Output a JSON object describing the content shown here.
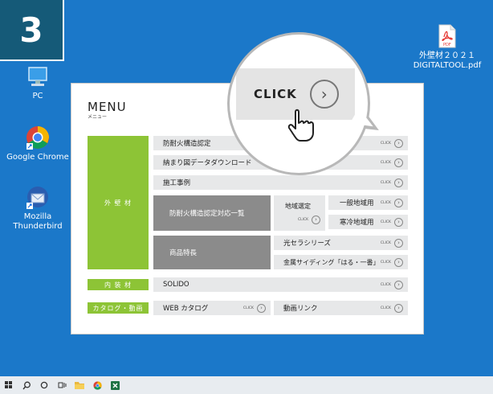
{
  "step": "3",
  "desktop": {
    "pc": "PC",
    "chrome": "Google Chrome",
    "thunderbird_line1": "Mozilla",
    "thunderbird_line2": "Thunderbird",
    "pdf_line1": "外壁材２０２１",
    "pdf_line2": "DIGITALTOOL.pdf",
    "pdf_badge": "PDF"
  },
  "menu": {
    "title": "MENU",
    "subtitle": "メニュー",
    "click_small": "CLICK",
    "sections": {
      "exterior": "外 壁 材",
      "interior": "内 装 材",
      "catalog": "カタログ・動画"
    },
    "items": {
      "fire": "防耐火構造認定",
      "cad": "納まり図データダウンロード",
      "cases": "施工事例",
      "fire_list": "防耐火構造認定対応一覧",
      "region": "地域選定",
      "general": "一般地域用",
      "cold": "寒冷地域用",
      "features": "商品特長",
      "hikari": "光セラシリーズ",
      "metal": "金属サイディング「はる・一番」",
      "solido": "SOLIDO",
      "web_catalog": "WEB カタログ",
      "video": "動画リンク"
    }
  },
  "callout": {
    "label": "CLICK"
  }
}
